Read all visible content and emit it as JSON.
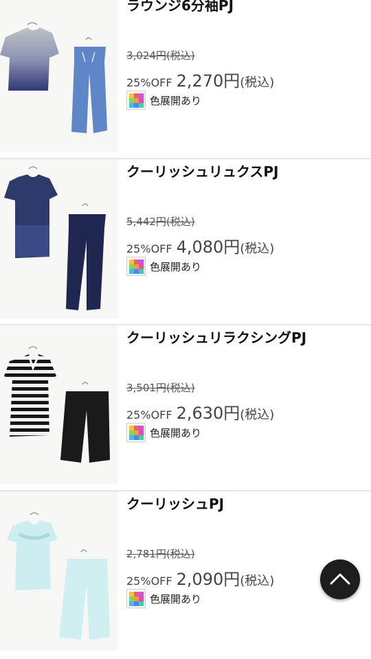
{
  "products": [
    {
      "name": "ラウンジ6分袖PJ",
      "original_price": "3,024円(税込)",
      "discount": "25%OFF",
      "price": "2,270円",
      "tax": "(税込)",
      "color_note": "色展開あり",
      "image": "gray-gradient-top-blue-pants"
    },
    {
      "name": "クーリッシュリュクスPJ",
      "original_price": "5,442円(税込)",
      "discount": "25%OFF",
      "price": "4,080円",
      "tax": "(税込)",
      "color_note": "色展開あり",
      "image": "navy-top-navy-pants"
    },
    {
      "name": "クーリッシュリラクシングPJ",
      "original_price": "3,501円(税込)",
      "discount": "25%OFF",
      "price": "2,630円",
      "tax": "(税込)",
      "color_note": "色展開あり",
      "image": "striped-top-black-shorts"
    },
    {
      "name": "クーリッシュPJ",
      "original_price": "2,781円(税込)",
      "discount": "25%OFF",
      "price": "2,090円",
      "tax": "(税込)",
      "color_note": "色展開あり",
      "image": "mint-top-mint-pants"
    }
  ],
  "scroll_top_icon": "chevron-up-icon",
  "colors": {
    "divider": "#e6e6e6",
    "scroll_button": "#1e1e1e",
    "price_text": "#444444"
  }
}
